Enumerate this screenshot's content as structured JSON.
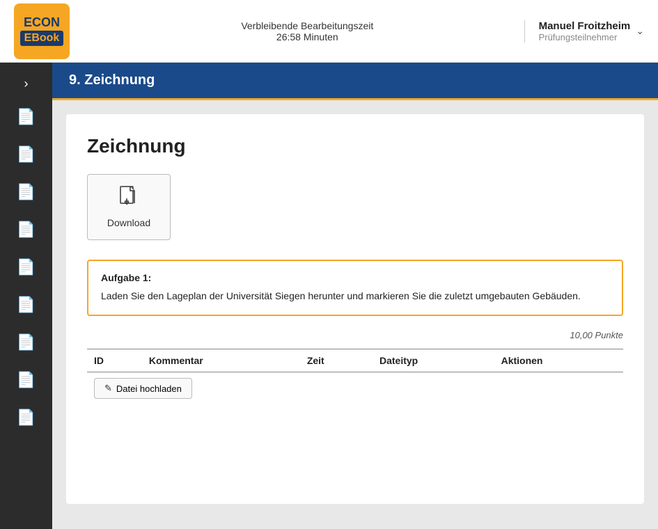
{
  "header": {
    "logo_econ": "ECON",
    "logo_ebook": "EBook",
    "timer_label": "Verbleibende Bearbeitungszeit",
    "timer_value": "26:58 Minuten",
    "user_name": "Manuel Froitzheim",
    "user_role": "Prüfungsteilnehmer"
  },
  "sidebar": {
    "toggle_icon": "›",
    "items": [
      {
        "icon": "📄"
      },
      {
        "icon": "📄"
      },
      {
        "icon": "📄"
      },
      {
        "icon": "📄"
      },
      {
        "icon": "📄"
      },
      {
        "icon": "📄"
      },
      {
        "icon": "📄"
      },
      {
        "icon": "📄"
      },
      {
        "icon": "📄"
      }
    ]
  },
  "section": {
    "title": "9. Zeichnung"
  },
  "card": {
    "title": "Zeichnung",
    "download_label": "Download",
    "task_title": "Aufgabe 1:",
    "task_text": "Laden Sie den Lageplan der Universität Siegen herunter und markieren Sie die zuletzt umgebauten Gebäuden.",
    "points": "10,00 Punkte",
    "table_headers": [
      "ID",
      "Kommentar",
      "Zeit",
      "Dateityp",
      "Aktionen"
    ],
    "upload_button_label": "Datei hochladen"
  },
  "colors": {
    "accent_orange": "#f5a623",
    "brand_blue": "#1a4a8a",
    "sidebar_bg": "#2c2c2c",
    "task_border": "#f5a623"
  }
}
